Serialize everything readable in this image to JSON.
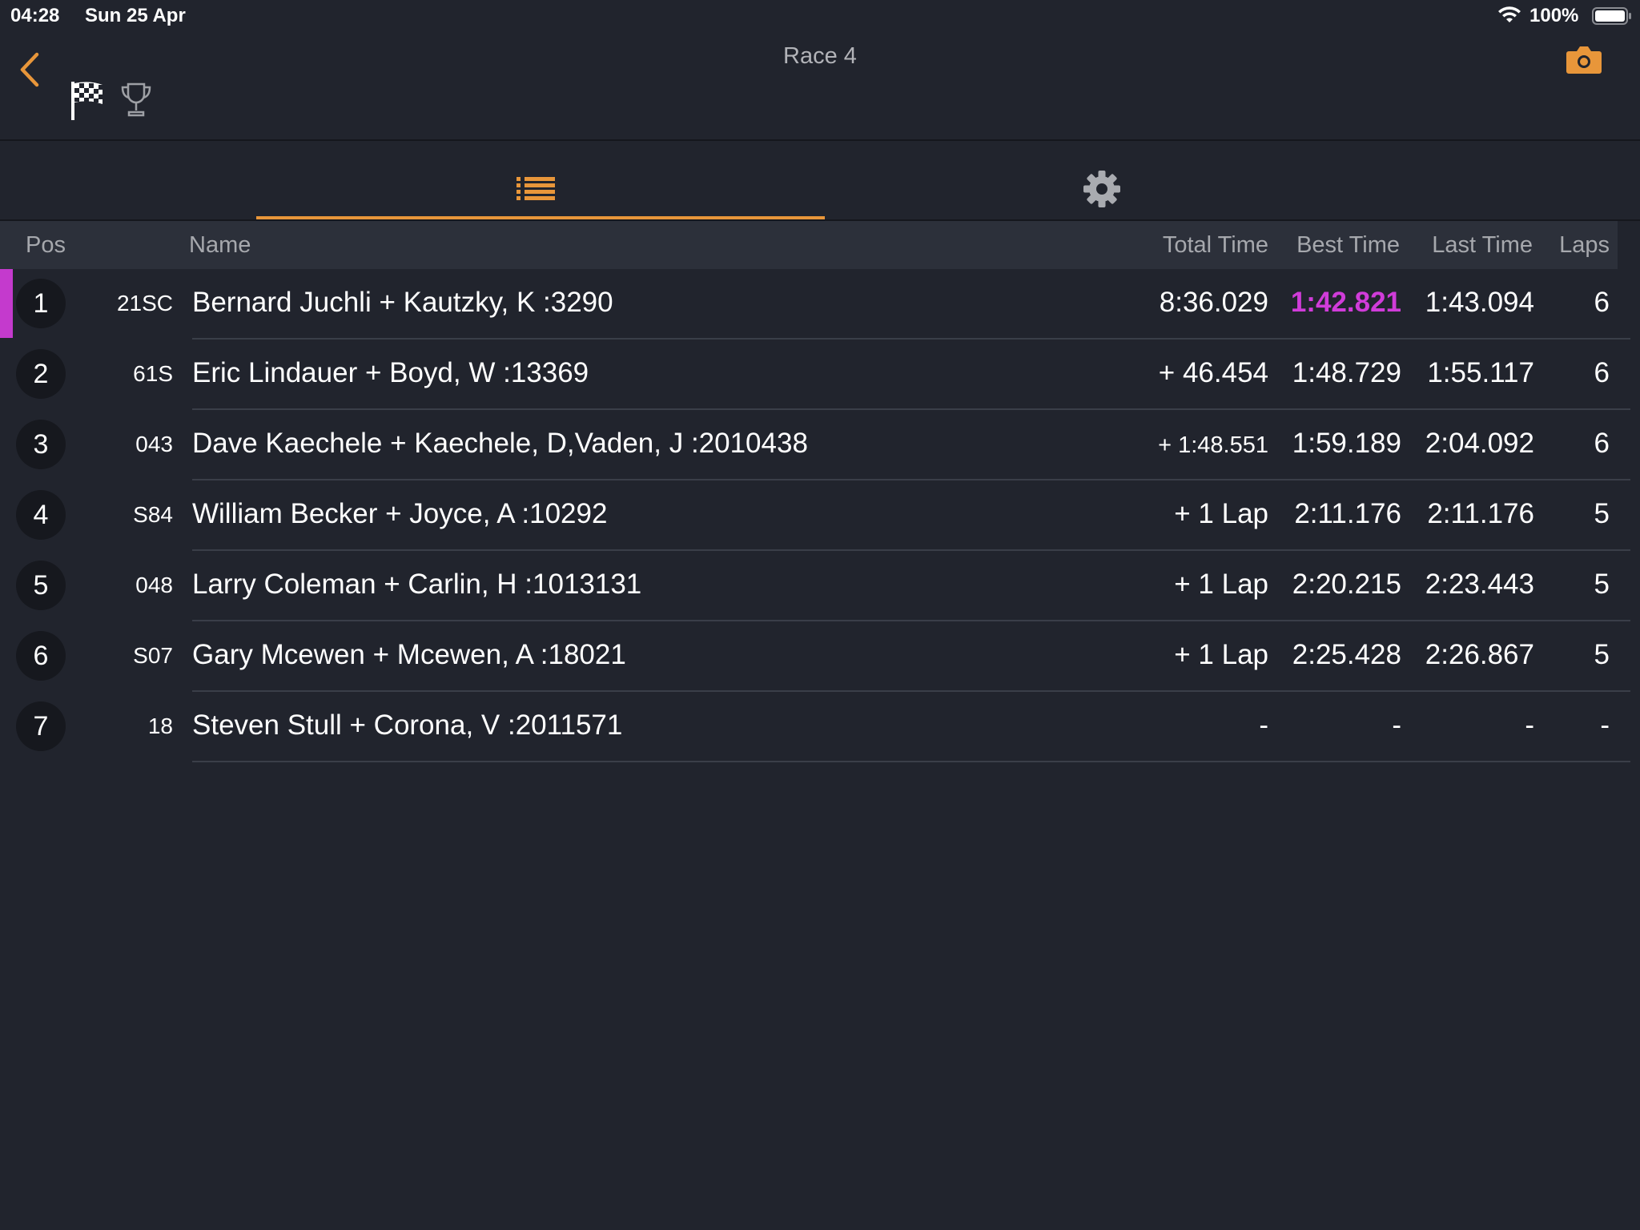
{
  "status": {
    "time": "04:28",
    "date": "Sun 25 Apr",
    "battery": "100%"
  },
  "nav": {
    "title": "Race 4",
    "icons": [
      "chevron-left-icon",
      "checkered-flag-icon",
      "trophy-icon",
      "camera-icon"
    ]
  },
  "tabs": [
    {
      "icon": "list-icon",
      "active": true
    },
    {
      "icon": "gear-icon",
      "active": false
    }
  ],
  "colors": {
    "accent": "#e8963a",
    "best_lap": "#d03cd9",
    "background": "#21242d",
    "header": "#2c303a"
  },
  "table": {
    "headers": {
      "pos": "Pos",
      "name": "Name",
      "total": "Total Time",
      "best": "Best Time",
      "last": "Last Time",
      "laps": "Laps"
    },
    "rows": [
      {
        "pos": "1",
        "number": "21SC",
        "name": "Bernard Juchli + Kautzky, K :3290",
        "total": "8:36.029",
        "best": "1:42.821",
        "last": "1:43.094",
        "laps": "6"
      },
      {
        "pos": "2",
        "number": "61S",
        "name": "Eric Lindauer + Boyd, W :13369",
        "total": "+ 46.454",
        "best": "1:48.729",
        "last": "1:55.117",
        "laps": "6"
      },
      {
        "pos": "3",
        "number": "043",
        "name": "Dave Kaechele + Kaechele, D,Vaden, J :2010438",
        "total": "+ 1:48.551",
        "best": "1:59.189",
        "last": "2:04.092",
        "laps": "6"
      },
      {
        "pos": "4",
        "number": "S84",
        "name": "William Becker + Joyce, A :10292",
        "total": "+ 1 Lap",
        "best": "2:11.176",
        "last": "2:11.176",
        "laps": "5"
      },
      {
        "pos": "5",
        "number": "048",
        "name": "Larry Coleman + Carlin, H :1013131",
        "total": "+ 1 Lap",
        "best": "2:20.215",
        "last": "2:23.443",
        "laps": "5"
      },
      {
        "pos": "6",
        "number": "S07",
        "name": "Gary Mcewen + Mcewen, A :18021",
        "total": "+ 1 Lap",
        "best": "2:25.428",
        "last": "2:26.867",
        "laps": "5"
      },
      {
        "pos": "7",
        "number": "18",
        "name": "Steven Stull + Corona, V :2011571",
        "total": "-",
        "best": "-",
        "last": "-",
        "laps": "-"
      }
    ]
  }
}
